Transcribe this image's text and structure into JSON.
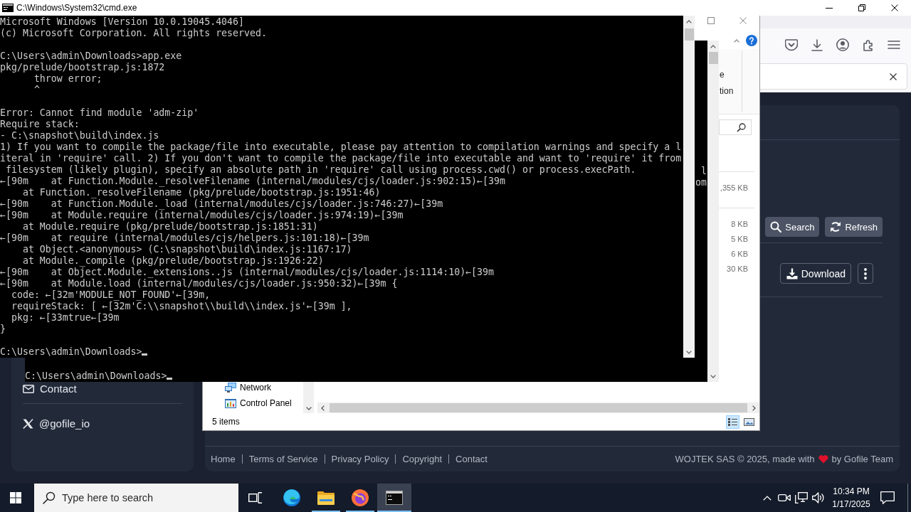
{
  "cmd_window": {
    "title": "C:\\Windows\\System32\\cmd.exe",
    "blocks": [
      [
        "Microsoft Windows [Version 10.0.19045.4046]",
        "(c) Microsoft Corporation. All rights reserved."
      ],
      [
        "C:\\Users\\admin\\Downloads>app.exe",
        "pkg/prelude/bootstrap.js:1872",
        "      throw error;",
        "      ^"
      ],
      [
        "Error: Cannot find module 'adm-zip'",
        "Require stack:",
        "- C:\\snapshot\\build\\index.js",
        "1) If you want to compile the package/file into executable, please pay attention to compilation warnings and specify a l",
        "iteral in 'require' call. 2) If you don't want to compile the package/file into executable and want to 'require' it from",
        " filesystem (likely plugin), specify an absolute path in 'require' call using process.cwd() or process.execPath.",
        "←[90m    at Function.Module._resolveFilename (internal/modules/cjs/loader.js:902:15)←[39m",
        "    at Function._resolveFilename (pkg/prelude/bootstrap.js:1951:46)",
        "←[90m    at Function.Module._load (internal/modules/cjs/loader.js:746:27)←[39m",
        "←[90m    at Module.require (internal/modules/cjs/loader.js:974:19)←[39m",
        "    at Module.require (pkg/prelude/bootstrap.js:1851:31)",
        "←[90m    at require (internal/modules/cjs/helpers.js:101:18)←[39m",
        "    at Object.<anonymous> (C:\\snapshot\\build\\index.js:1167:17)",
        "    at Module._compile (pkg/prelude/bootstrap.js:1926:22)",
        "←[90m    at Object.Module._extensions..js (internal/modules/cjs/loader.js:1114:10)←[39m",
        "←[90m    at Module.load (internal/modules/cjs/loader.js:950:32)←[39m {",
        "  code: ←[32m'MODULE_NOT_FOUND'←[39m,",
        "  requireStack: [ ←[32m'C:\\\\snapshot\\\\build\\\\index.js'←[39m ],",
        "  pkg: ←[33mtrue←[39m",
        "}"
      ]
    ],
    "prompt": "C:\\Users\\admin\\Downloads>"
  },
  "cmd_window_2": {
    "lines": [
      "l",
      "om"
    ],
    "prompt": "C:\\Users\\admin\\Downloads>"
  },
  "explorer": {
    "ribbon_fragments": [
      "e",
      "tion"
    ],
    "groups": [
      {
        "files": [
          {
            "size": ",355 KB"
          }
        ]
      },
      {
        "files": [
          {
            "size": "8 KB"
          },
          {
            "size": "5 KB"
          },
          {
            "size": "6 KB"
          },
          {
            "size": "30 KB"
          }
        ]
      }
    ],
    "nav_items": [
      {
        "kind": "network",
        "label": "Network"
      },
      {
        "kind": "control_panel",
        "label": "Control Panel"
      }
    ],
    "status": "5 items",
    "views": [
      {
        "kind": "details",
        "selected": true
      },
      {
        "kind": "large_icons",
        "selected": false
      }
    ]
  },
  "browser": {
    "sidebar": [
      {
        "kind": "email",
        "label": "Contact"
      },
      {
        "kind": "x",
        "label": "@gofile_io"
      }
    ],
    "toolbar_buttons": [
      {
        "kind": "search",
        "label": "Search"
      },
      {
        "kind": "refresh",
        "label": "Refresh"
      }
    ],
    "file_actions": [
      {
        "kind": "download",
        "label": "Download"
      },
      {
        "kind": "more"
      }
    ],
    "footer": {
      "links": [
        "Home",
        "Terms of Service",
        "Privacy Policy",
        "Copyright",
        "Contact"
      ],
      "credit_start": "WOJTEK SAS © 2025, made with",
      "credit_end": "by Gofile Team"
    }
  },
  "taskbar": {
    "search_placeholder": "Type here to search",
    "apps": [
      {
        "kind": "edge",
        "running": false,
        "selected": false
      },
      {
        "kind": "explorer",
        "running": true,
        "selected": false
      },
      {
        "kind": "firefox",
        "running": true,
        "selected": false
      },
      {
        "kind": "terminal",
        "running": true,
        "selected": true
      }
    ],
    "clock": {
      "time": "10:34 PM",
      "date": "1/17/2025"
    }
  }
}
